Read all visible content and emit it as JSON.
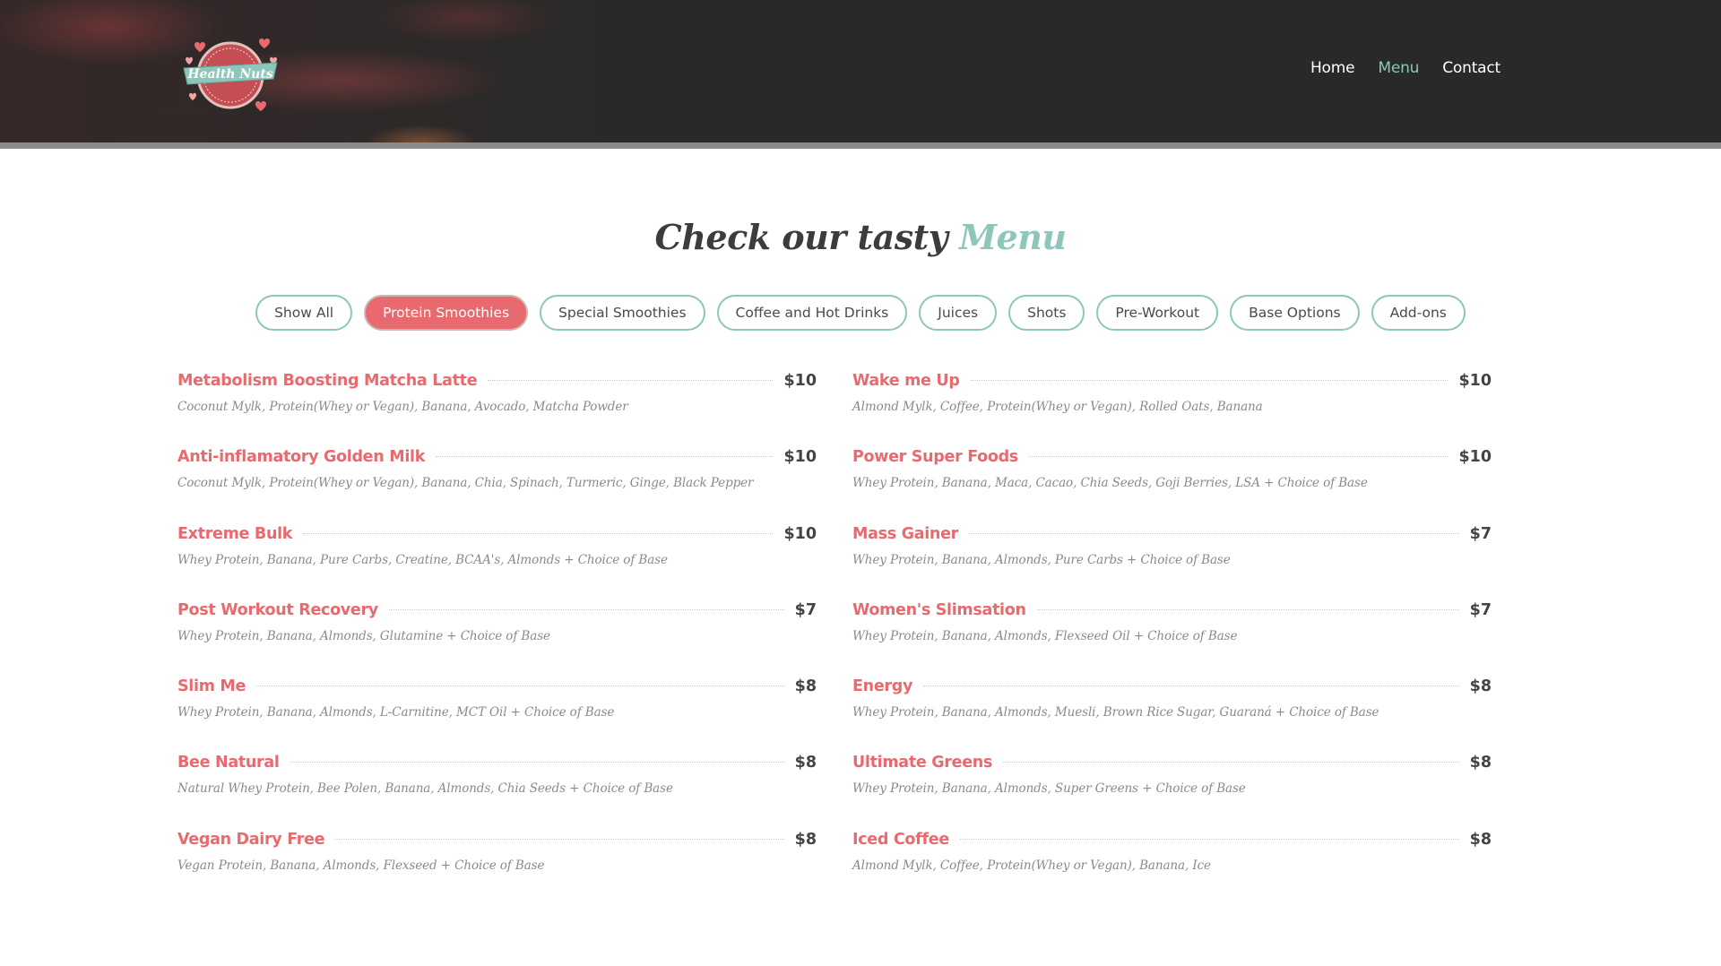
{
  "brand": {
    "logo_text": "Health Nuts",
    "accent_color": "#8dc6ba",
    "primary_color": "#e96a6e"
  },
  "nav": {
    "items": [
      {
        "label": "Home",
        "active": false
      },
      {
        "label": "Menu",
        "active": true
      },
      {
        "label": "Contact",
        "active": false
      }
    ]
  },
  "section": {
    "title_main": "Check our tasty",
    "title_accent": "Menu"
  },
  "filters": [
    {
      "label": "Show All",
      "active": false
    },
    {
      "label": "Protein Smoothies",
      "active": true
    },
    {
      "label": "Special Smoothies",
      "active": false
    },
    {
      "label": "Coffee and Hot Drinks",
      "active": false
    },
    {
      "label": "Juices",
      "active": false
    },
    {
      "label": "Shots",
      "active": false
    },
    {
      "label": "Pre-Workout",
      "active": false
    },
    {
      "label": "Base Options",
      "active": false
    },
    {
      "label": "Add-ons",
      "active": false
    }
  ],
  "menu": {
    "items": [
      {
        "name": "Metabolism Boosting Matcha Latte",
        "price": "$10",
        "desc": "Coconut Mylk, Protein(Whey or Vegan), Banana, Avocado, Matcha Powder"
      },
      {
        "name": "Wake me Up",
        "price": "$10",
        "desc": "Almond Mylk, Coffee, Protein(Whey or Vegan), Rolled Oats, Banana"
      },
      {
        "name": "Anti-inflamatory Golden Milk",
        "price": "$10",
        "desc": "Coconut Mylk, Protein(Whey or Vegan), Banana, Chia, Spinach, Turmeric, Ginge, Black Pepper"
      },
      {
        "name": "Power Super Foods",
        "price": "$10",
        "desc": "Whey Protein, Banana, Maca, Cacao, Chia Seeds, Goji Berries, LSA + Choice of Base"
      },
      {
        "name": "Extreme Bulk",
        "price": "$10",
        "desc": "Whey Protein, Banana, Pure Carbs, Creatine, BCAA's, Almonds + Choice of Base"
      },
      {
        "name": "Mass Gainer",
        "price": "$7",
        "desc": "Whey Protein, Banana, Almonds, Pure Carbs + Choice of Base"
      },
      {
        "name": "Post Workout Recovery",
        "price": "$7",
        "desc": "Whey Protein, Banana, Almonds, Glutamine + Choice of Base"
      },
      {
        "name": "Women's Slimsation",
        "price": "$7",
        "desc": "Whey Protein, Banana, Almonds, Flexseed Oil + Choice of Base"
      },
      {
        "name": "Slim Me",
        "price": "$8",
        "desc": "Whey Protein, Banana, Almonds, L-Carnitine, MCT Oil + Choice of Base"
      },
      {
        "name": "Energy",
        "price": "$8",
        "desc": "Whey Protein, Banana, Almonds, Muesli, Brown Rice Sugar, Guaraná + Choice of Base"
      },
      {
        "name": "Bee Natural",
        "price": "$8",
        "desc": "Natural Whey Protein, Bee Polen, Banana, Almonds, Chia Seeds + Choice of Base"
      },
      {
        "name": "Ultimate Greens",
        "price": "$8",
        "desc": "Whey Protein, Banana, Almonds, Super Greens + Choice of Base"
      },
      {
        "name": "Vegan Dairy Free",
        "price": "$8",
        "desc": "Vegan Protein, Banana, Almonds, Flexseed + Choice of Base"
      },
      {
        "name": "Iced Coffee",
        "price": "$8",
        "desc": "Almond Mylk, Coffee, Protein(Whey or Vegan), Banana, Ice"
      }
    ]
  }
}
